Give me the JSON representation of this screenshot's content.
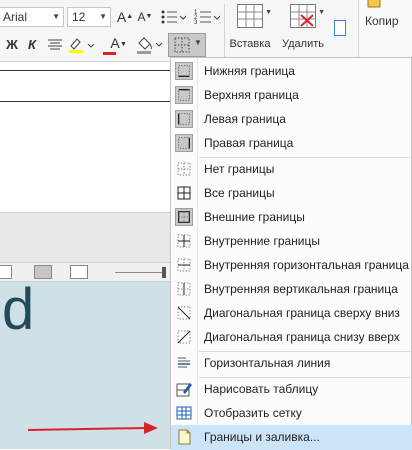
{
  "toolbar": {
    "font_name": "Arial",
    "font_size": "12",
    "grow_font": "A",
    "shrink_font": "A",
    "bold": "Ж",
    "italic": "К",
    "font_color_letter": "A",
    "font_color": "#d9232b",
    "insert_label": "Вставка",
    "delete_label": "Удалить",
    "copy_label": "Копир"
  },
  "document": {
    "big_letter": "d"
  },
  "borders_menu": {
    "items": [
      {
        "label": "Нижняя граница",
        "icon": "bottom-border-icon"
      },
      {
        "label": "Верхняя граница",
        "icon": "top-border-icon"
      },
      {
        "label": "Левая граница",
        "icon": "left-border-icon"
      },
      {
        "label": "Правая граница",
        "icon": "right-border-icon"
      },
      {
        "label": "Нет границы",
        "icon": "no-border-icon"
      },
      {
        "label": "Все границы",
        "icon": "all-borders-icon"
      },
      {
        "label": "Внешние границы",
        "icon": "outside-borders-icon"
      },
      {
        "label": "Внутренние границы",
        "icon": "inside-borders-icon"
      },
      {
        "label": "Внутренняя горизонтальная граница",
        "icon": "inside-horizontal-border-icon"
      },
      {
        "label": "Внутренняя вертикальная граница",
        "icon": "inside-vertical-border-icon"
      },
      {
        "label": "Диагональная граница сверху вниз",
        "icon": "diagonal-down-border-icon"
      },
      {
        "label": "Диагональная граница снизу вверх",
        "icon": "diagonal-up-border-icon"
      },
      {
        "label": "Горизонтальная линия",
        "icon": "horizontal-line-icon"
      },
      {
        "label": "Нарисовать таблицу",
        "icon": "draw-table-icon"
      },
      {
        "label": "Отобразить сетку",
        "icon": "view-gridlines-icon"
      },
      {
        "label": "Границы и заливка...",
        "icon": "borders-shading-icon"
      }
    ]
  },
  "colors": {
    "accent_red": "#d9232b",
    "menu_highlight": "#cce4f7",
    "doc_blue": "#cfe0e6",
    "heading_text": "#234a59"
  }
}
